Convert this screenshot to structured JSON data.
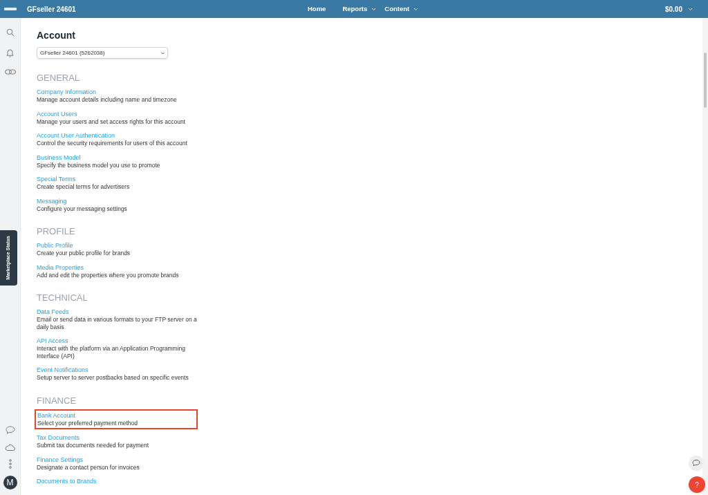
{
  "top_bar": {
    "account_name": "GFseller 24601",
    "nav": [
      {
        "label": "Home",
        "has_menu": false
      },
      {
        "label": "Reports",
        "has_menu": true
      },
      {
        "label": "Content",
        "has_menu": true
      }
    ],
    "balance": "$0.00"
  },
  "side_tab": "Marketplace Status",
  "avatar": "M",
  "page": {
    "title": "Account",
    "account_select": "GFseller 24601 (5262038)",
    "sections": [
      {
        "heading": "GENERAL",
        "items": [
          {
            "link": "Company Information",
            "description": "Manage account details including name and timezone",
            "highlighted": false
          },
          {
            "link": "Account Users",
            "description": "Manage your users and set access rights for this account",
            "highlighted": false
          },
          {
            "link": "Account User Authentication",
            "description": "Control the security requirements for users of this account",
            "highlighted": false
          },
          {
            "link": "Business Model",
            "description": "Specify the business model you use to promote",
            "highlighted": false
          },
          {
            "link": "Special Terms",
            "description": "Create special terms for advertisers",
            "highlighted": false
          },
          {
            "link": "Messaging",
            "description": "Configure your messaging settings",
            "highlighted": false
          }
        ]
      },
      {
        "heading": "PROFILE",
        "items": [
          {
            "link": "Public Profile",
            "description": "Create your public profile for brands",
            "highlighted": false
          },
          {
            "link": "Media Properties",
            "description": "Add and edit the properties where you promote brands",
            "highlighted": false
          }
        ]
      },
      {
        "heading": "TECHNICAL",
        "items": [
          {
            "link": "Data Feeds",
            "description": "Email or send data in various formats to your FTP server on a daily basis",
            "highlighted": false
          },
          {
            "link": "API Access",
            "description": "Interact with the platform via an Application Programming Interface (API)",
            "highlighted": false
          },
          {
            "link": "Event Notifications",
            "description": "Setup server to server postbacks based on specific events",
            "highlighted": false
          }
        ]
      },
      {
        "heading": "FINANCE",
        "items": [
          {
            "link": "Bank Account",
            "description": "Select your preferred payment method",
            "highlighted": true
          },
          {
            "link": "Tax Documents",
            "description": "Submit tax documents needed for payment",
            "highlighted": false
          },
          {
            "link": "Finance Settings",
            "description": "Designate a contact person for invoices",
            "highlighted": false
          },
          {
            "link": "Documents to Brands",
            "highlighted": false
          }
        ]
      }
    ]
  },
  "help_button": "?"
}
